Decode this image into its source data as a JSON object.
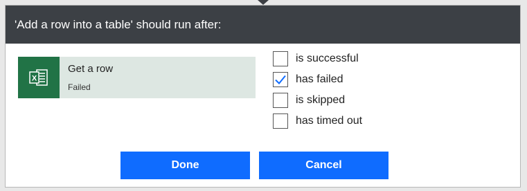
{
  "dialog": {
    "title": "'Add a row into a table' should run after:"
  },
  "action": {
    "title": "Get a row",
    "status": "Failed",
    "icon": "excel-icon",
    "icon_color": "#217346",
    "card_color": "#dde7e2"
  },
  "options": [
    {
      "label": "is successful",
      "checked": false
    },
    {
      "label": "has failed",
      "checked": true
    },
    {
      "label": "is skipped",
      "checked": false
    },
    {
      "label": "has timed out",
      "checked": false
    }
  ],
  "buttons": {
    "done_label": "Done",
    "cancel_label": "Cancel",
    "color": "#0f6cff"
  },
  "colors": {
    "header_bg": "#3c4045",
    "checkmark": "#0f6cff"
  }
}
